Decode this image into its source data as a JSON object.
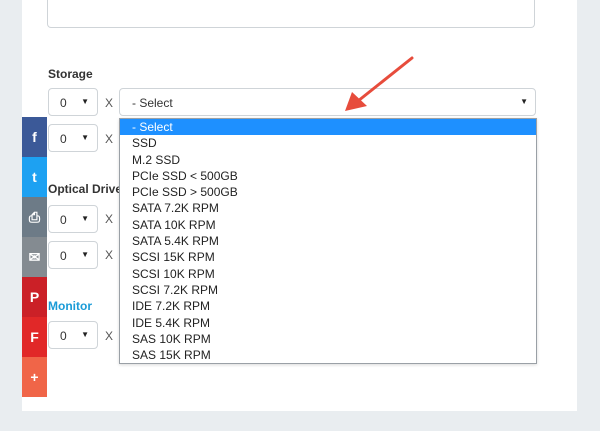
{
  "top_field": {
    "value": ""
  },
  "storage": {
    "label": "Storage",
    "rows": [
      {
        "qty": "0",
        "x": "X",
        "select_value": "- Select"
      },
      {
        "qty": "0",
        "x": "X"
      }
    ]
  },
  "optical_drive": {
    "label": "Optical Drive",
    "rows": [
      {
        "qty": "0",
        "x": "X"
      },
      {
        "qty": "0",
        "x": "X"
      }
    ]
  },
  "monitor": {
    "label": "Monitor",
    "rows": [
      {
        "qty": "0",
        "x": "X"
      }
    ]
  },
  "dropdown": {
    "options": [
      "- Select",
      "SSD",
      "M.2 SSD",
      "PCIe SSD < 500GB",
      "PCIe SSD > 500GB",
      "SATA 7.2K RPM",
      "SATA 10K RPM",
      "SATA 5.4K RPM",
      "SCSI 15K RPM",
      "SCSI 10K RPM",
      "SCSI 7.2K RPM",
      "IDE 7.2K RPM",
      "IDE 5.4K RPM",
      "SAS 10K RPM",
      "SAS 15K RPM"
    ],
    "selected_index": 0
  },
  "icons": {
    "select_arrow": "▼",
    "social": [
      {
        "name": "facebook-icon",
        "glyph": "f",
        "color": "#3b5998"
      },
      {
        "name": "twitter-icon",
        "glyph": "t",
        "color": "#1da1f2"
      },
      {
        "name": "print-icon",
        "glyph": "⎙",
        "color": "#6d7b87"
      },
      {
        "name": "email-icon",
        "glyph": "✉",
        "color": "#848b91"
      },
      {
        "name": "pinterest-icon",
        "glyph": "P",
        "color": "#cb2027"
      },
      {
        "name": "flipboard-icon",
        "glyph": "F",
        "color": "#e12828"
      },
      {
        "name": "more-icon",
        "glyph": "+",
        "color": "#f06548"
      }
    ]
  },
  "colors": {
    "accent": "#1e90ff",
    "monitor_label": "#1a9bd7",
    "arrow": "#e74c3c"
  }
}
